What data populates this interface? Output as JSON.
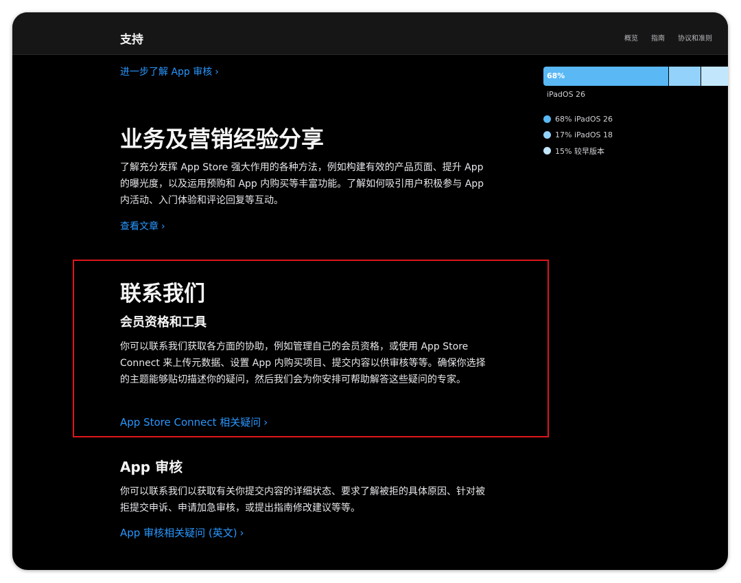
{
  "nav": {
    "title": "支持",
    "links": [
      "概览",
      "指南",
      "协议和准则"
    ]
  },
  "top_link": "进一步了解 App 审核",
  "section_business": {
    "title": "业务及营销经验分享",
    "body": "了解充分发挥 App Store 强大作用的各种方法，例如构建有效的产品页面、提升 App 的曝光度，以及运用预购和 App 内购买等丰富功能。了解如何吸引用户积极参与 App 内活动、入门体验和评论回复等互动。",
    "link": "查看文章"
  },
  "section_contact": {
    "title": "联系我们",
    "subtitle": "会员资格和工具",
    "body": "你可以联系我们获取各方面的协助，例如管理自己的会员资格，或使用 App Store Connect 来上传元数据、设置 App 内购买项目、提交内容以供审核等等。确保你选择的主题能够贴切描述你的疑问，然后我们会为你安排可帮助解答这些疑问的专家。",
    "link": "App Store Connect 相关疑问"
  },
  "section_review": {
    "title": "App 审核",
    "body": "你可以联系我们以获取有关你提交内容的详细状态、要求了解被拒的具体原因、针对被拒提交申诉、申请加急审核，或提出指南修改建议等等。",
    "link": "App 审核相关疑问 (英文)"
  },
  "chevron": "›",
  "usage_chart": {
    "bar_label": "68%",
    "caption": "iPadOS 26",
    "segments": [
      {
        "label": "68% iPadOS 26",
        "value": 68,
        "color": "#5ab8f5"
      },
      {
        "label": "17% iPadOS 18",
        "value": 17,
        "color": "#93d2fa"
      },
      {
        "label": "15% 较早版本",
        "value": 15,
        "color": "#c2e7fd"
      }
    ]
  },
  "colors": {
    "link": "#2997ff",
    "highlight": "#e0161d"
  }
}
